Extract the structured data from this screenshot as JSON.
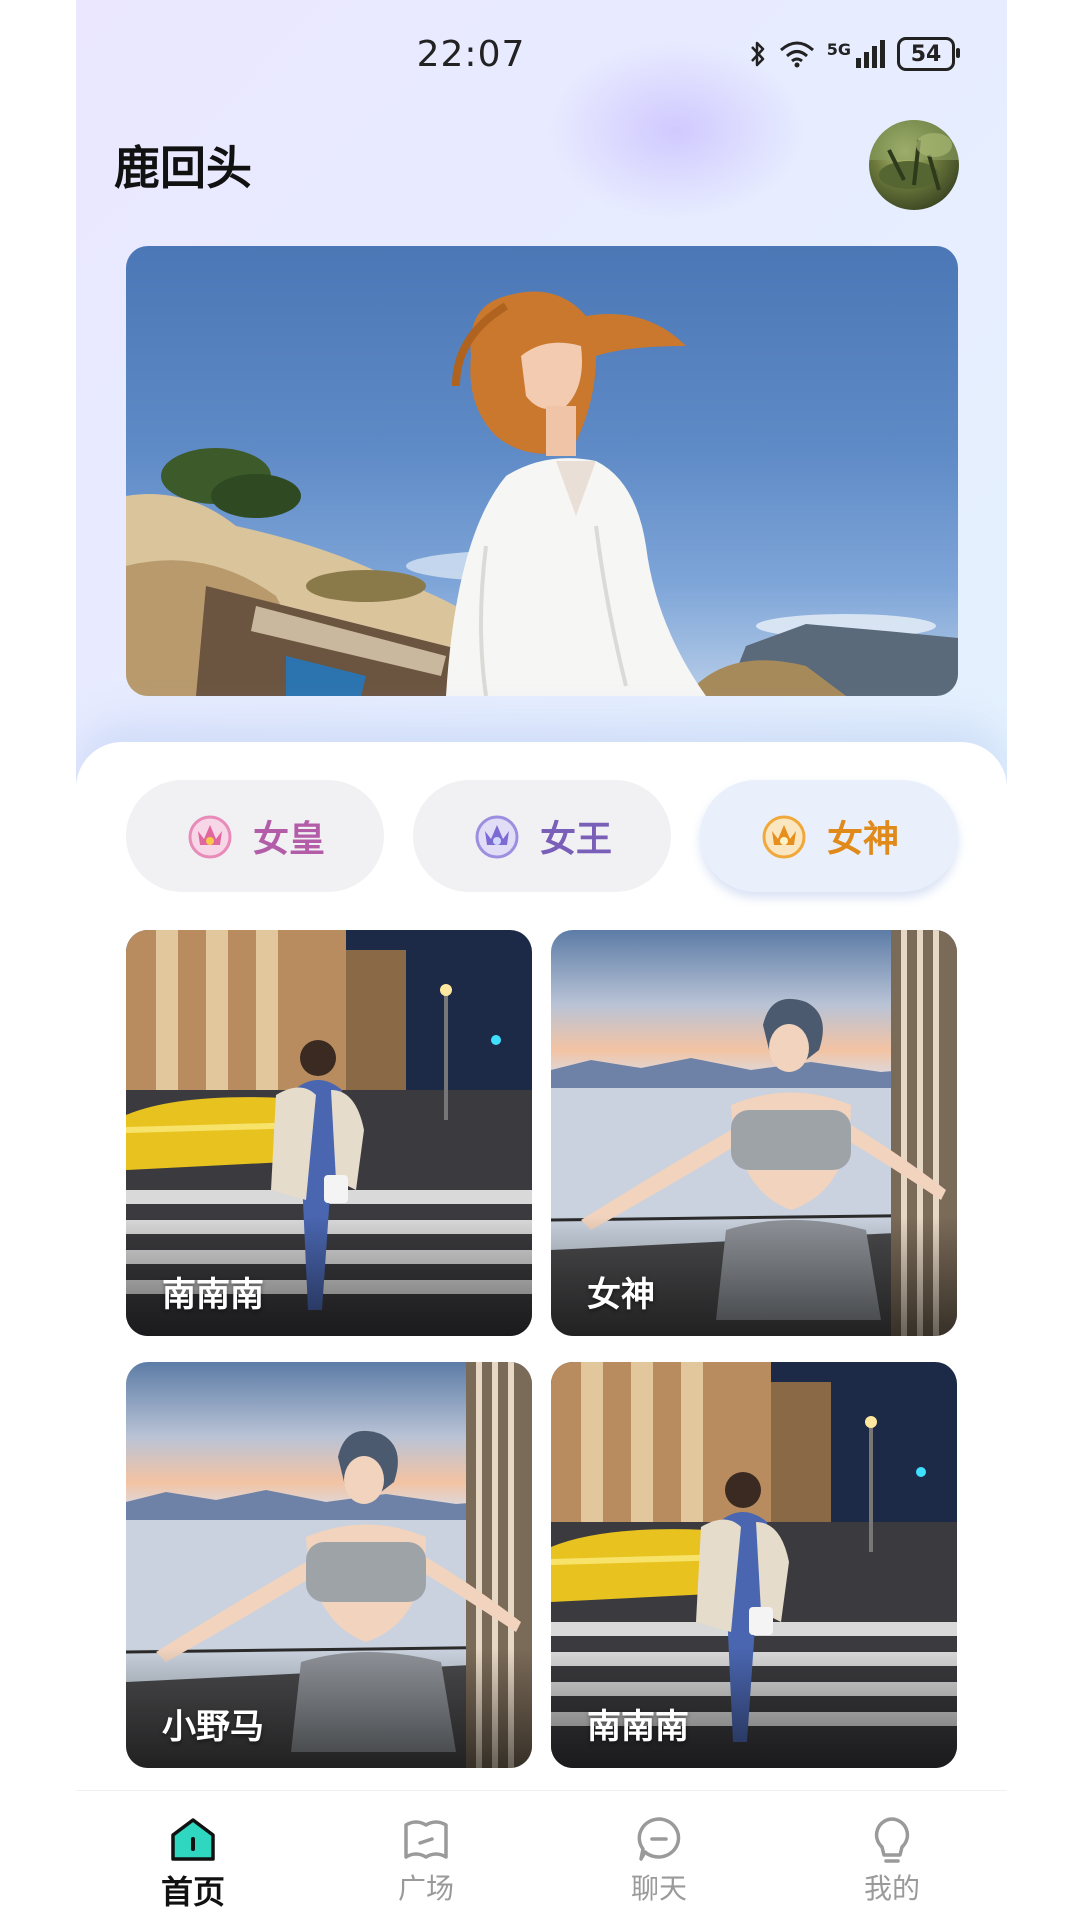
{
  "status_bar": {
    "time": "22:07",
    "battery": "54",
    "network": "5G"
  },
  "header": {
    "title": "鹿回头"
  },
  "categories": [
    {
      "label": "女皇",
      "color": "#b35ca8"
    },
    {
      "label": "女王",
      "color": "#7a5fb8"
    },
    {
      "label": "女神",
      "color": "#e08a1c"
    }
  ],
  "selected_category": "女神",
  "cards": [
    {
      "name": "南南南"
    },
    {
      "name": "女神"
    },
    {
      "name": "小野马"
    },
    {
      "name": "南南南"
    }
  ],
  "tabbar": {
    "tabs": [
      {
        "label": "首页",
        "icon": "home-icon",
        "active": true
      },
      {
        "label": "广场",
        "icon": "map-icon",
        "active": false
      },
      {
        "label": "聊天",
        "icon": "chat-bubble-icon",
        "active": false
      },
      {
        "label": "我的",
        "icon": "profile-bulb-icon",
        "active": false
      }
    ]
  },
  "colors": {
    "accent": "#2fd6c0",
    "inactive": "#9a9a9a"
  }
}
